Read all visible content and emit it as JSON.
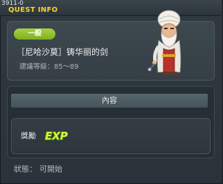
{
  "window": {
    "quest_id": "3911-0",
    "title": "QUEST INFO"
  },
  "quest": {
    "tag": "一般",
    "name": "［尼哈沙莫］铸华丽的剑",
    "level_requirement": "建議等級：85～89",
    "npc_icon": "old-man-npc-icon"
  },
  "content": {
    "header": "內容",
    "reward_label": "獎勵",
    "reward_icon": "exp-icon",
    "reward_icon_text": "EXP"
  },
  "status": {
    "label": "狀態：",
    "value": "可開始"
  },
  "colors": {
    "title": "#f0d23a",
    "tag_badge": "#8fbf2c",
    "exp_fill": "#e6f23a",
    "exp_outline": "#2f7a1a"
  }
}
